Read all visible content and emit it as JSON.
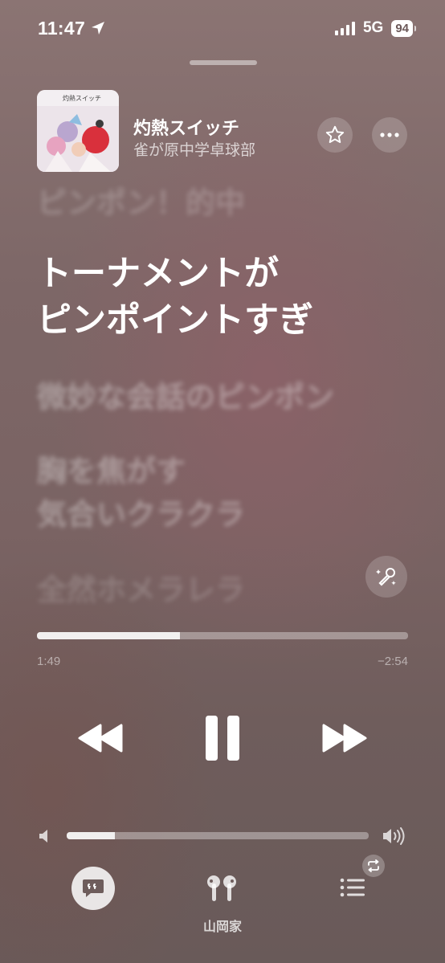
{
  "status_bar": {
    "time": "11:47",
    "network": "5G",
    "battery": "94"
  },
  "now_playing": {
    "title": "灼熱スイッチ",
    "artist": "雀が原中学卓球部",
    "artwork_title": "灼熱スイッチ"
  },
  "lyrics": {
    "previous": "ピンポン！的中",
    "current_line1": "トーナメントが",
    "current_line2": "ピンポイントすぎ",
    "next1": "微妙な会話のピンポン",
    "next2_line1": "胸を焦がす",
    "next2_line2": "気合いクラクラ",
    "next3": "全然ホメラレラ"
  },
  "playback": {
    "elapsed": "1:49",
    "remaining": "−2:54",
    "progress": 0.386,
    "volume": 0.16,
    "is_playing": true
  },
  "bottom_bar": {
    "airplay_device": "山岡家",
    "items": [
      "lyrics-icon",
      "airpods-icon",
      "queue-icon"
    ]
  },
  "colors": {
    "background": "#7d6767",
    "accent_text": "#ffffff"
  }
}
